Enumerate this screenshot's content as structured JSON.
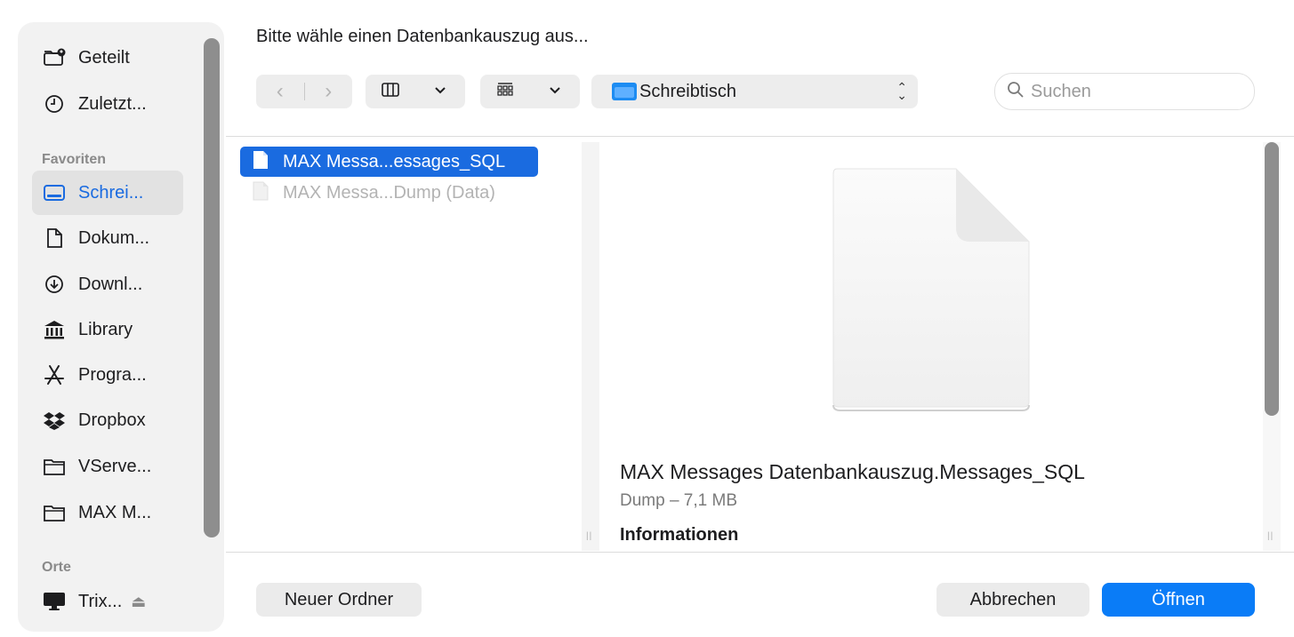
{
  "dialog": {
    "prompt": "Bitte wähle einen Datenbankauszug aus...",
    "colors": {
      "accent": "#1a6be0",
      "primary_button": "#0a7cf7"
    }
  },
  "sidebar": {
    "items_top": [
      {
        "label": "Geteilt",
        "icon": "shared-folder-icon"
      },
      {
        "label": "Zuletzt...",
        "icon": "clock-icon"
      }
    ],
    "favorites_title": "Favoriten",
    "favorites": [
      {
        "label": "Schrei...",
        "icon": "desktop-icon",
        "selected": true
      },
      {
        "label": "Dokum...",
        "icon": "document-icon"
      },
      {
        "label": "Downl...",
        "icon": "download-icon"
      },
      {
        "label": "Library",
        "icon": "library-icon"
      },
      {
        "label": "Progra...",
        "icon": "applications-icon"
      },
      {
        "label": "Dropbox",
        "icon": "dropbox-icon"
      },
      {
        "label": "VServe...",
        "icon": "folder-icon"
      },
      {
        "label": "MAX M...",
        "icon": "folder-icon"
      }
    ],
    "places_title": "Orte",
    "places": [
      {
        "label": "Trix...",
        "icon": "computer-icon",
        "eject": "⏏"
      }
    ]
  },
  "toolbar": {
    "back": "‹",
    "forward": "›",
    "location": "Schreibtisch",
    "search_placeholder": "Suchen"
  },
  "files": [
    {
      "name": "MAX Messa...essages_SQL",
      "selected": true
    },
    {
      "name": "MAX Messa...Dump (Data)",
      "selected": false
    }
  ],
  "preview": {
    "name": "MAX Messages Datenbankauszug.Messages_SQL",
    "kind": "Dump – 7,1 MB",
    "info_heading": "Informationen"
  },
  "buttons": {
    "new_folder": "Neuer Ordner",
    "cancel": "Abbrechen",
    "open": "Öffnen"
  }
}
